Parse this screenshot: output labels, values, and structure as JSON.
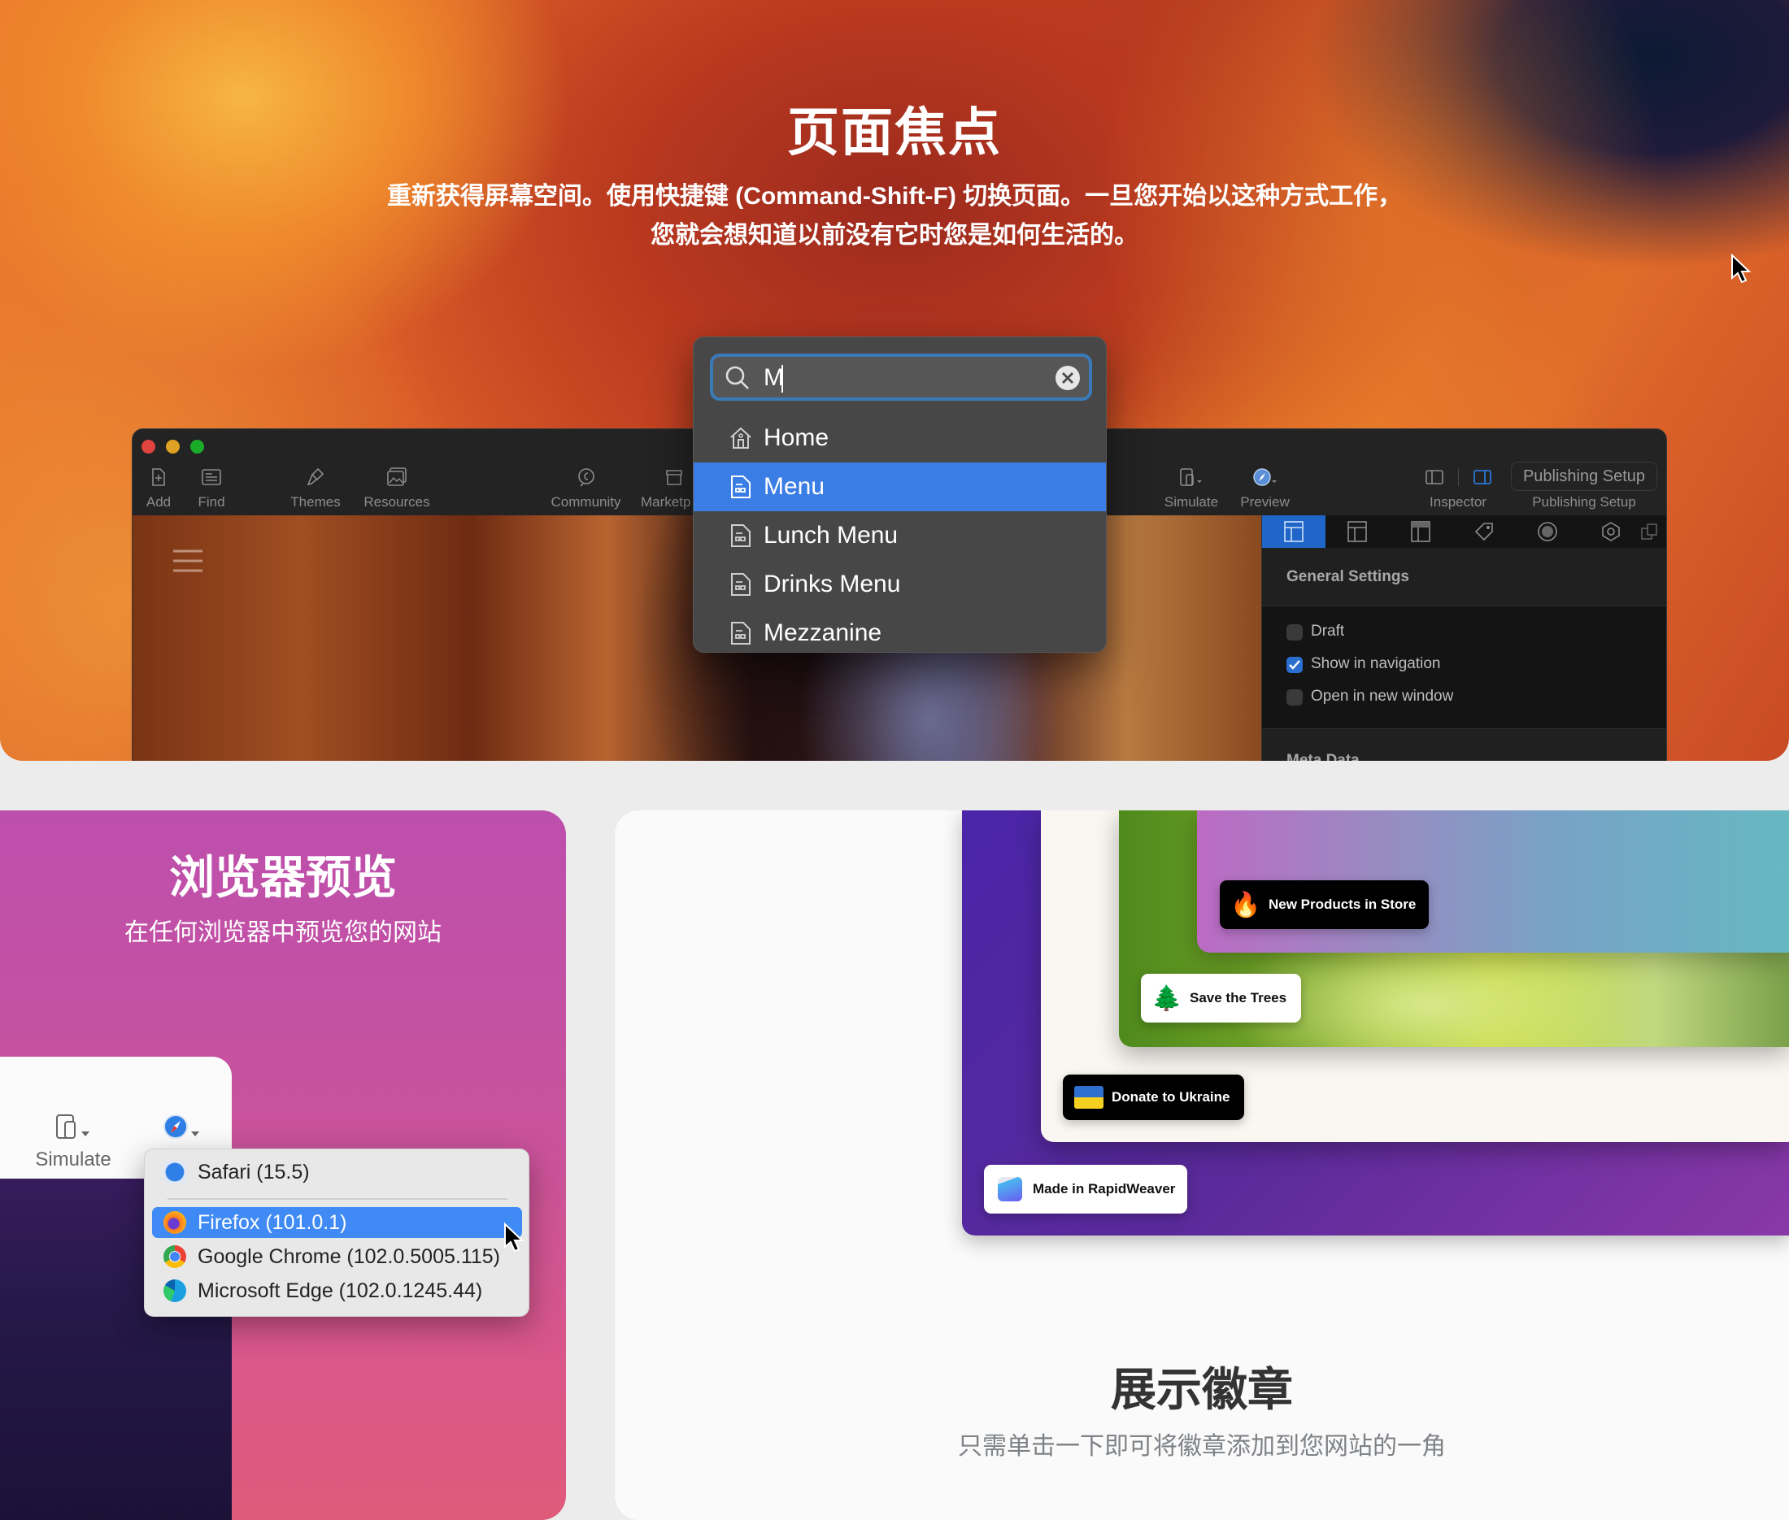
{
  "hero": {
    "title": "页面焦点",
    "subtitle_line1": "重新获得屏幕空间。使用快捷键 (Command-Shift-F) 切换页面。一旦您开始以这种方式工作，",
    "subtitle_line2": "您就会想知道以前没有它时您是如何生活的。"
  },
  "app_window": {
    "toolbar": {
      "items": [
        {
          "label": "Add",
          "icon": "add-page-icon"
        },
        {
          "label": "Find",
          "icon": "find-icon"
        },
        {
          "label": "Themes",
          "icon": "themes-brush-icon"
        },
        {
          "label": "Resources",
          "icon": "resources-image-icon"
        },
        {
          "label": "Community",
          "icon": "community-chat-icon"
        },
        {
          "label": "Marketp",
          "icon": "marketplace-store-icon"
        },
        {
          "label": "Simulate",
          "icon": "simulate-device-icon"
        },
        {
          "label": "Preview",
          "icon": "safari-compass-icon"
        },
        {
          "label": "Inspector",
          "icon": "inspector-panel-icon"
        },
        {
          "label": "Publishing Setup",
          "icon": ""
        }
      ],
      "publishing_button": "Publishing Setup"
    },
    "inspector": {
      "section_general": "General Settings",
      "checkboxes": [
        {
          "label": "Draft",
          "checked": false
        },
        {
          "label": "Show in navigation",
          "checked": true
        },
        {
          "label": "Open in new window",
          "checked": false
        }
      ],
      "section_meta": "Meta Data"
    },
    "accent": "#1f66c8"
  },
  "page_focus_popup": {
    "search_value": "M",
    "items": [
      {
        "label": "Home",
        "icon": "home-icon",
        "selected": false
      },
      {
        "label": "Menu",
        "icon": "page-icon",
        "selected": true
      },
      {
        "label": "Lunch Menu",
        "icon": "page-icon",
        "selected": false
      },
      {
        "label": "Drinks Menu",
        "icon": "page-icon",
        "selected": false
      },
      {
        "label": "Mezzanine",
        "icon": "page-icon",
        "selected": false
      }
    ],
    "highlight_color": "#3a7de4"
  },
  "browser_preview": {
    "title": "浏览器预览",
    "subtitle": "在任何浏览器中预览您的网站",
    "simulate_label": "Simulate",
    "browsers": [
      {
        "label": "Safari (15.5)",
        "icon": "safari-icon",
        "selected": false
      },
      {
        "label": "Firefox (101.0.1)",
        "icon": "firefox-icon",
        "selected": true
      },
      {
        "label": "Google Chrome (102.0.5005.115)",
        "icon": "chrome-icon",
        "selected": false
      },
      {
        "label": "Microsoft Edge (102.0.1245.44)",
        "icon": "edge-icon",
        "selected": false
      }
    ]
  },
  "badges_section": {
    "title": "展示徽章",
    "subtitle": "只需单击一下即可将徽章添加到您网站的一角",
    "badges": [
      {
        "label": "New Products in Store",
        "emoji": "🔥",
        "style": "dark"
      },
      {
        "label": "Save the Trees",
        "emoji": "🌲",
        "style": "light"
      },
      {
        "label": "Donate to Ukraine",
        "emoji": "🇺🇦",
        "style": "dark"
      },
      {
        "label": "Made in RapidWeaver",
        "emoji": "",
        "style": "light"
      }
    ]
  }
}
